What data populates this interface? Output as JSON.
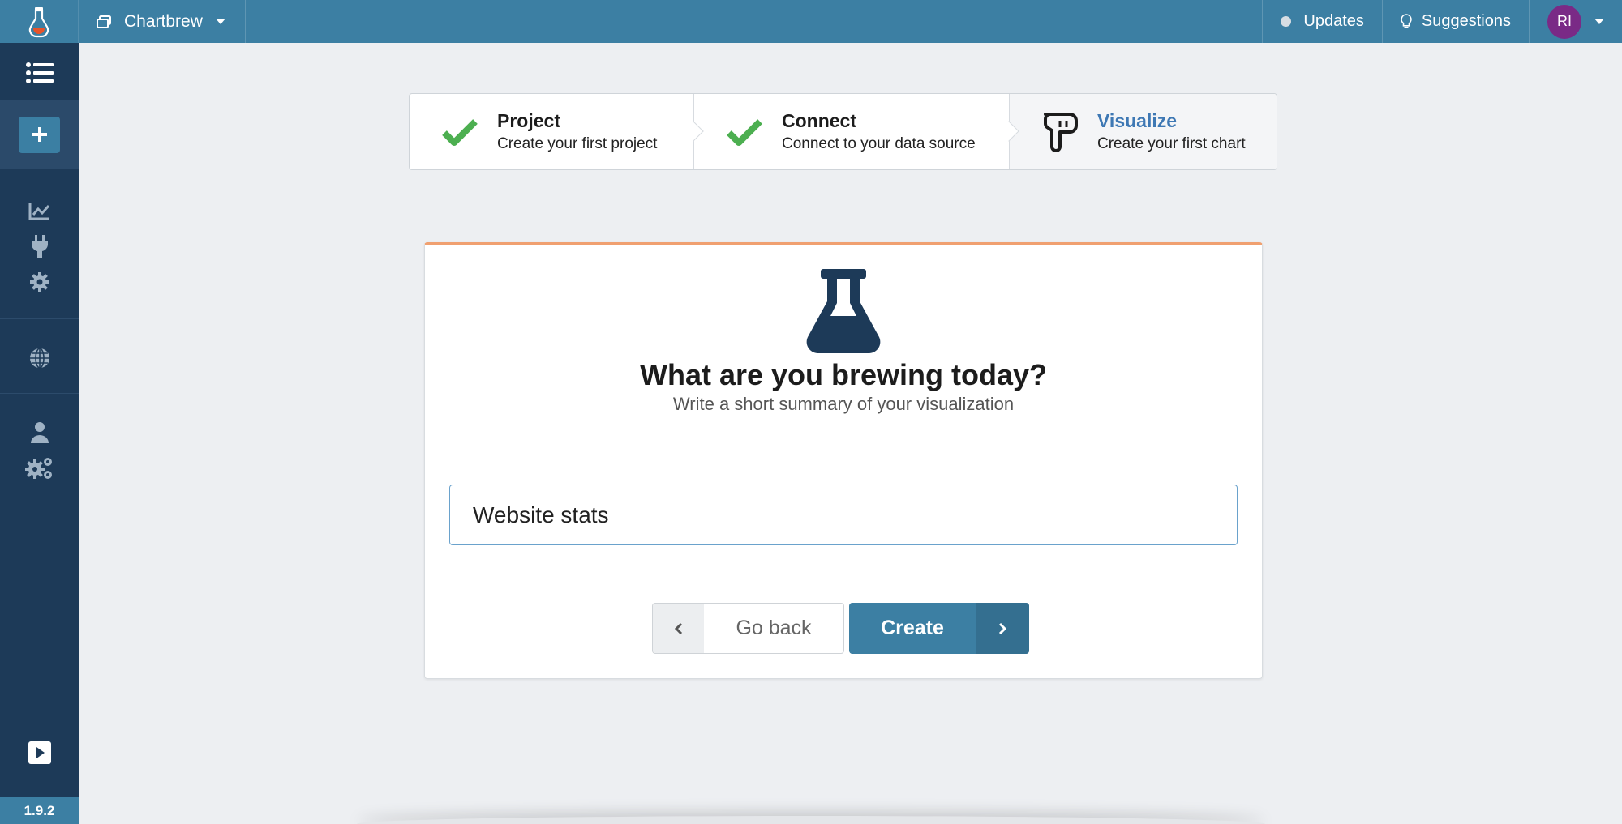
{
  "topbar": {
    "project_name": "Chartbrew",
    "updates_label": "Updates",
    "suggestions_label": "Suggestions",
    "avatar_initials": "RI"
  },
  "sidebar": {
    "icons": [
      "list-icon",
      "plus-icon",
      "chart-line-icon",
      "plug-icon",
      "gear-icon",
      "globe-icon",
      "user-icon",
      "gears-icon",
      "play-square-icon"
    ],
    "version": "1.9.2"
  },
  "stepper": {
    "steps": [
      {
        "title": "Project",
        "description": "Create your first project",
        "status": "complete"
      },
      {
        "title": "Connect",
        "description": "Connect to your data source",
        "status": "complete"
      },
      {
        "title": "Visualize",
        "description": "Create your first chart",
        "status": "active"
      }
    ]
  },
  "card": {
    "heading": "What are you brewing today?",
    "subheading": "Write a short summary of your visualization",
    "input_value": "Website stats",
    "back_label": "Go back",
    "create_label": "Create"
  },
  "colors": {
    "topbar": "#3c7fa3",
    "sidebar": "#1d3a58",
    "check": "#4caf50",
    "active_step": "#3e78b4",
    "card_accent": "#f0a070",
    "avatar": "#7a2a86"
  }
}
